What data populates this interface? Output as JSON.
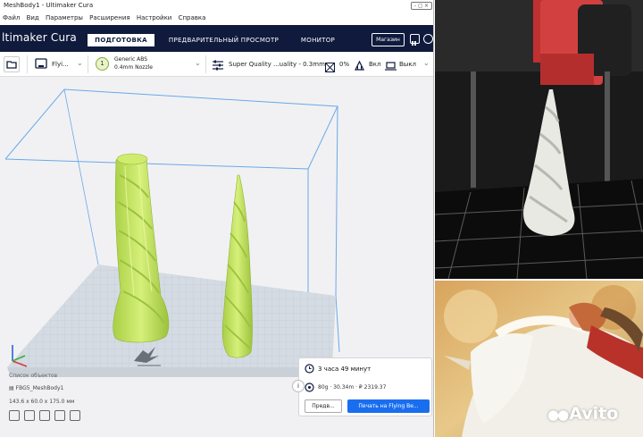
{
  "window": {
    "title": "MeshBody1 - Ultimaker Cura",
    "controls": "- ◻ ×"
  },
  "menu": [
    "Файл",
    "Вид",
    "Параметры",
    "Расширения",
    "Настройки",
    "Справка"
  ],
  "header": {
    "logo_text": "ltimaker Cura",
    "stages": [
      "ПОДГОТОВКА",
      "ПРЕДВАРИТЕЛЬНЫЙ ПРОСМОТР",
      "МОНИТОР"
    ],
    "active_stage": "ПОДГОТОВКА",
    "marketplace_label": "Магазин"
  },
  "toolbar": {
    "printer_name": "Flyi...",
    "material_slot": "1",
    "material_name": "Generic ABS",
    "nozzle": "0.4mm Nozzle",
    "print_profile": "Super Quality ...uality - 0.3mm",
    "infill": "0%",
    "support": "Вкл",
    "adhesion": "Выкл"
  },
  "object_list": {
    "title": "Список объектов",
    "object_name": "FBG5_MeshBody1",
    "dimensions": "143.6 x 60.0 x 175.0 мм"
  },
  "print_info": {
    "time": "3 часа 49 минут",
    "material_usage": "80g · 30.34m · ₽ 2319.37",
    "preview_button": "Предв...",
    "print_button": "Печать на Flying Be..."
  },
  "watermark": "Avito",
  "colors": {
    "header_bg": "#0f1a3c",
    "accent_blue": "#196ef0",
    "model_green": "#c7e86a",
    "build_volume": "#6aa8e8"
  }
}
